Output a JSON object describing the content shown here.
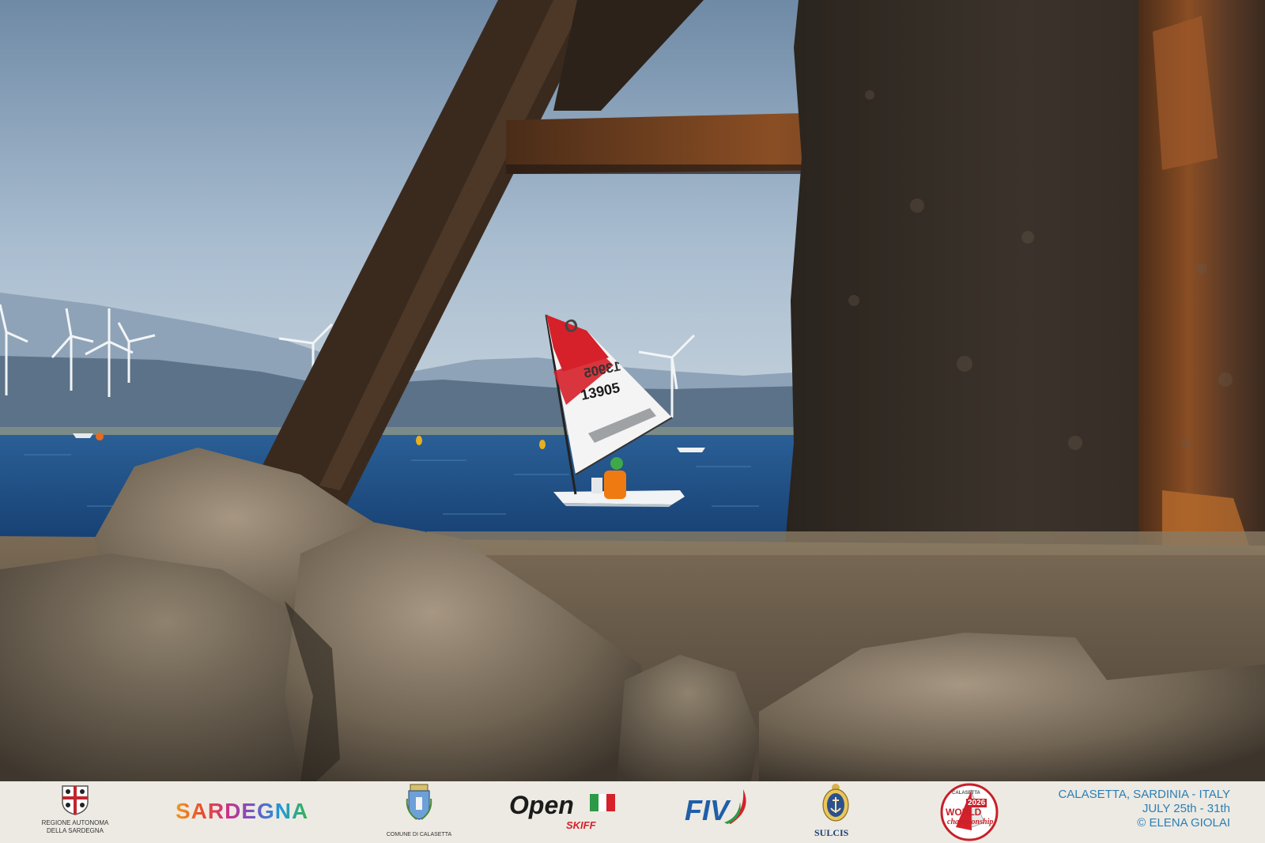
{
  "photo": {
    "sail_number": "13905",
    "sail_mirror_number": "13905",
    "sail_logo": "O"
  },
  "footer": {
    "sponsors": {
      "regione": {
        "line1": "REGIONE AUTONOMA",
        "line2": "DELLA SARDEGNA",
        "icon": "sardinia-coat-of-arms-icon"
      },
      "sardegna": {
        "text": "SARDEGNA"
      },
      "comune": {
        "caption": "COMUNE DI CALASETTA",
        "icon": "calasetta-crest-icon"
      },
      "open_skiff": {
        "open": "Open",
        "skiff": "SKIFF",
        "icon": "italian-flag-icon"
      },
      "fiv": {
        "text": "FIV"
      },
      "sulcis": {
        "text": "SULCIS",
        "icon": "anchor-crest-icon"
      },
      "world": {
        "text": "WORLD",
        "year": "2026",
        "script": "championship",
        "top": "CALASETTA"
      }
    },
    "credit": {
      "line1": "CALASETTA, SARDINIA - ITALY",
      "line2": "JULY  25th - 31th",
      "line3": "© ELENA GIOLAI"
    }
  },
  "colors": {
    "sky": "#a7bccf",
    "sea": "#1d4f86",
    "rust": "#6b3e22",
    "sail_red": "#d6202a",
    "credit_blue": "#2b7fb6"
  }
}
